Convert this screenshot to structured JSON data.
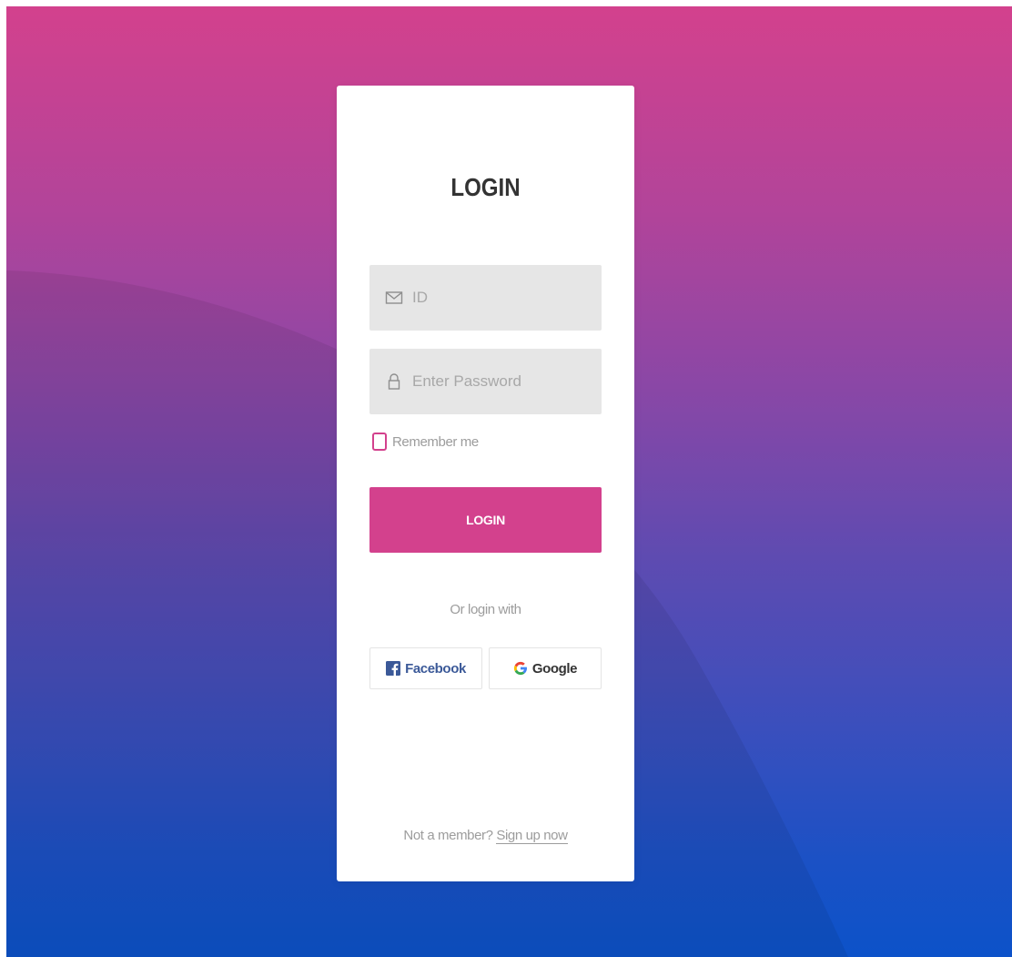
{
  "theme": {
    "accent": "#d3418d",
    "gradient_top": "#d3418d",
    "gradient_bottom": "#0c52c9",
    "facebook": "#3b5998"
  },
  "login": {
    "title": "LOGIN",
    "id_field": {
      "icon": "envelope-icon",
      "placeholder": "ID",
      "value": ""
    },
    "password_field": {
      "icon": "lock-icon",
      "placeholder": "Enter Password",
      "value": ""
    },
    "remember_label": "Remember me",
    "remember_checked": false,
    "login_button": "LOGIN",
    "or_text": "Or login with",
    "social": {
      "facebook": {
        "icon": "facebook-icon",
        "label": "Facebook"
      },
      "google": {
        "icon": "google-icon",
        "label": "Google"
      }
    },
    "footer_text": "Not a member?",
    "signup_link": "Sign up now"
  }
}
